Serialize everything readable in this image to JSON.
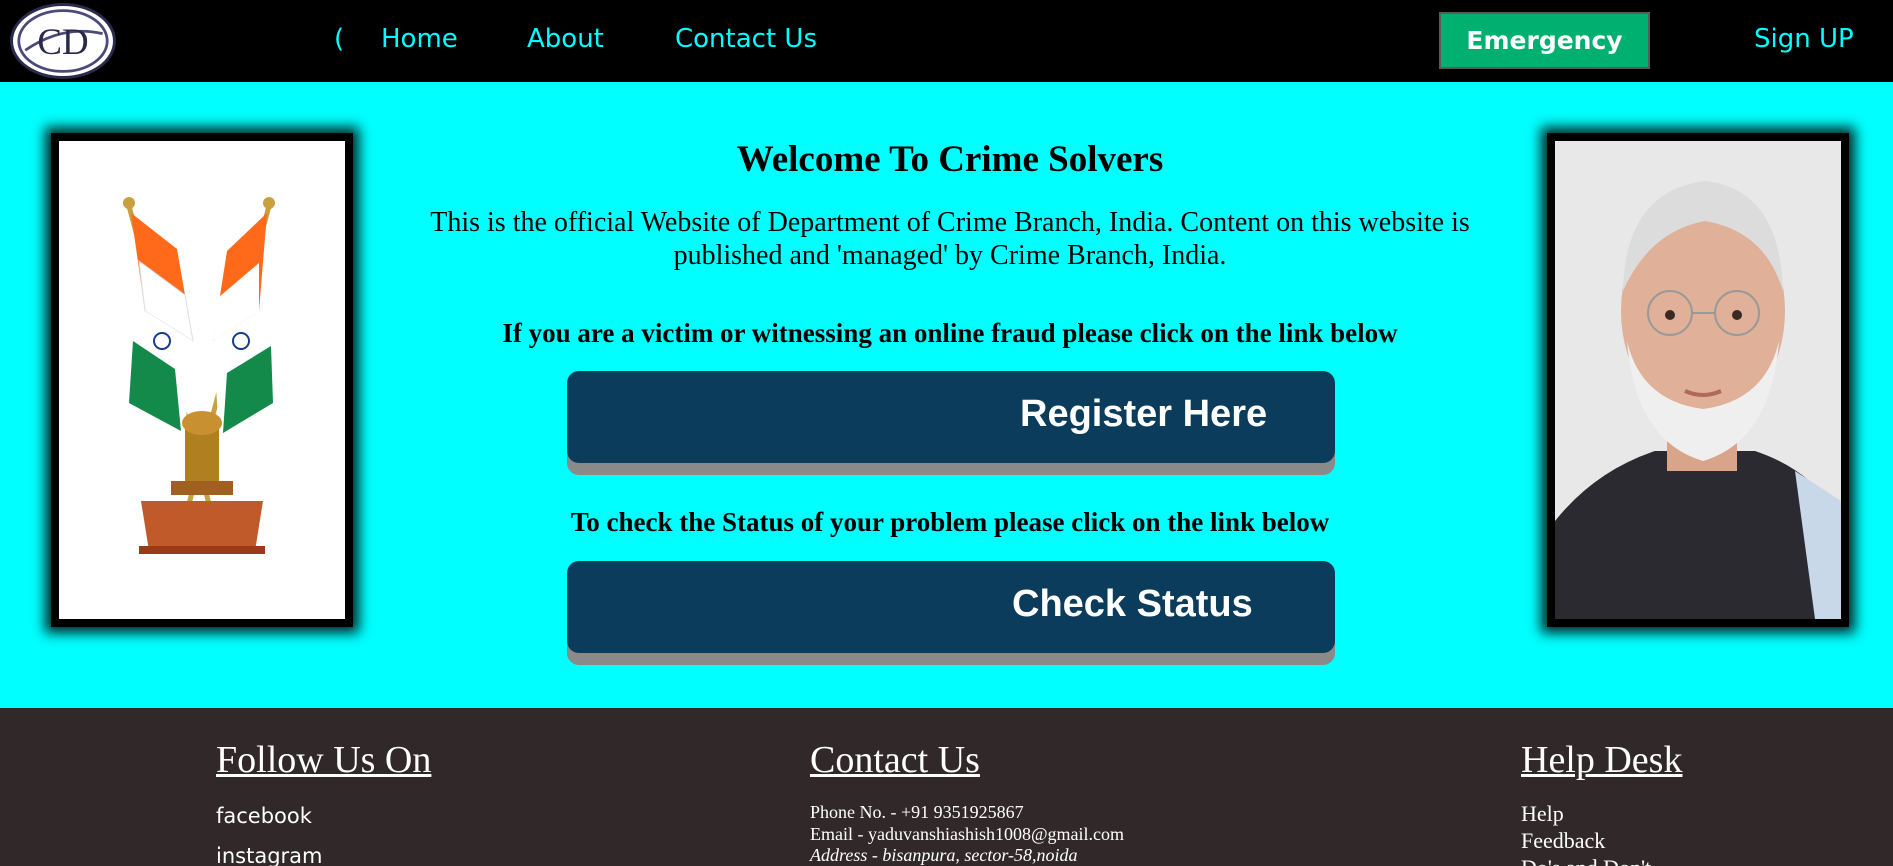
{
  "nav": {
    "logo_text": "CD",
    "partial_link": "(",
    "home": "Home",
    "about": "About",
    "contact": "Contact Us",
    "emergency": "Emergency",
    "signup": "Sign UP"
  },
  "main": {
    "welcome": "Welcome To Crime Solvers",
    "intro": "This is the official Website of Department of Crime Branch, India. Content on this website is published and 'managed' by Crime Branch, India.",
    "prompt_register": "If you are a victim or witnessing an online fraud please click on the link below",
    "register_button": "Register Here",
    "prompt_status": "To check the Status of your problem please click on the link below",
    "status_button": "Check Status"
  },
  "footer": {
    "follow": {
      "heading": "Follow Us On",
      "links": [
        "facebook",
        "instagram"
      ]
    },
    "contact": {
      "heading": "Contact Us",
      "phone": "Phone No. - +91 9351925867",
      "email": "Email - yaduvanshiashish1008@gmail.com",
      "address": "Address - bisanpura, sector-58,noida"
    },
    "help": {
      "heading": "Help Desk",
      "items": [
        "Help",
        "Feedback",
        "Do's and Don't"
      ]
    }
  },
  "colors": {
    "nav_bg": "#000000",
    "nav_link": "#00ffff",
    "page_bg": "#00ffff",
    "emergency_bg": "#00b070",
    "button_bg": "#0c3c5c",
    "footer_bg": "#312929"
  }
}
